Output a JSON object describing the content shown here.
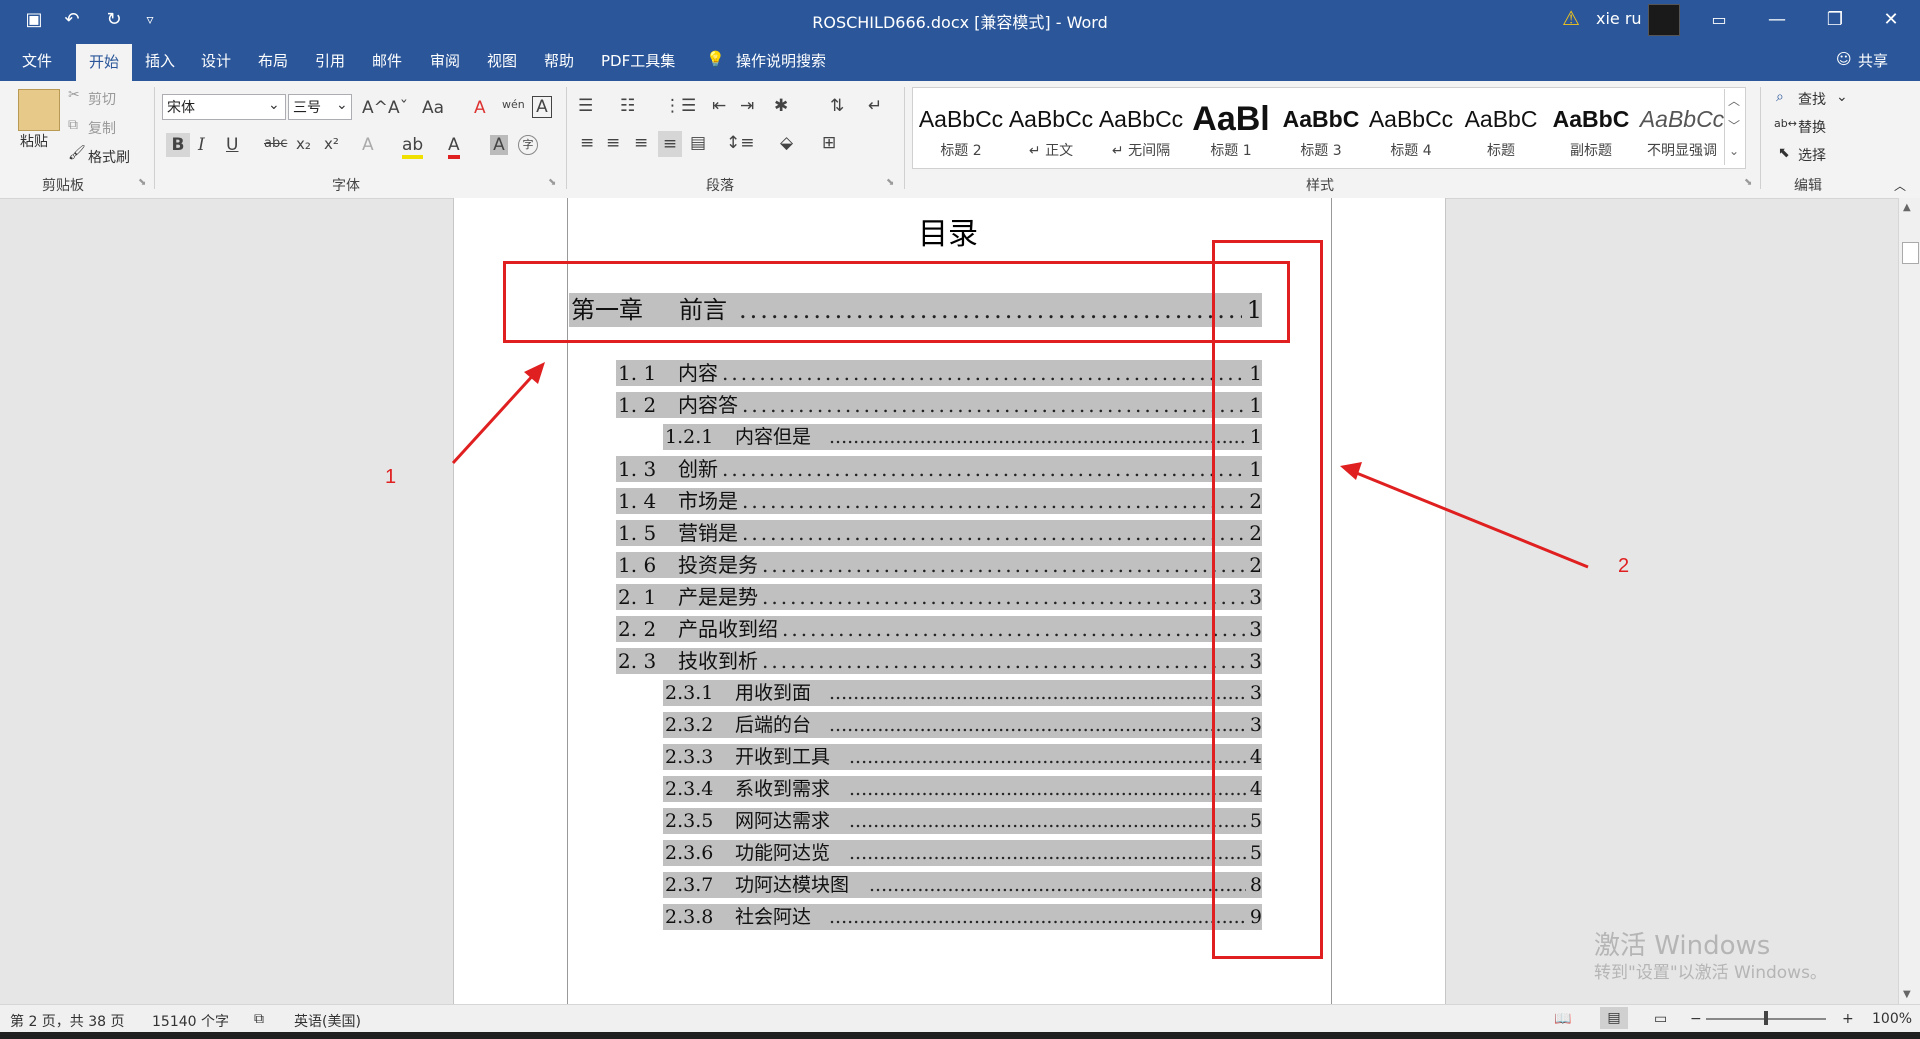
{
  "window": {
    "title": "ROSCHILD666.docx [兼容模式]  -  Word",
    "user": "xie ru",
    "controls": {
      "ribbon_opts": "▭",
      "minimize": "—",
      "restore": "❐",
      "close": "✕"
    }
  },
  "quick_access": {
    "save": "▣",
    "undo": "↶",
    "redo": "↻",
    "customize": "▿"
  },
  "tabs": [
    "文件",
    "开始",
    "插入",
    "设计",
    "布局",
    "引用",
    "邮件",
    "审阅",
    "视图",
    "帮助",
    "PDF工具集"
  ],
  "tell_me": "操作说明搜索",
  "share": "共享",
  "ribbon": {
    "clipboard": {
      "paste": "粘贴",
      "cut": "剪切",
      "copy": "复制",
      "format_painter": "格式刷",
      "label": "剪贴板"
    },
    "font": {
      "name": "宋体",
      "size": "三号",
      "label": "字体",
      "bold": "B",
      "italic": "I",
      "underline": "U",
      "strike": "abc",
      "sub": "x₂",
      "sup": "x²",
      "grow": "A^",
      "shrink": "Aˇ",
      "case": "Aa",
      "clear": "A",
      "phonetic": "wén",
      "border_char": "A",
      "text_effect": "A",
      "highlight": "ab",
      "font_color": "A",
      "shading": "A",
      "enclose": "字"
    },
    "paragraph": {
      "label": "段落"
    },
    "styles": {
      "label": "样式",
      "items": [
        {
          "sample": "AaBbCc",
          "name": "标题 2"
        },
        {
          "sample": "AaBbCc",
          "name": "↵ 正文"
        },
        {
          "sample": "AaBbCc",
          "name": "↵ 无间隔"
        },
        {
          "sample": "AaBl",
          "name": "标题 1"
        },
        {
          "sample": "AaBbC",
          "name": "标题 3"
        },
        {
          "sample": "AaBbCc",
          "name": "标题 4"
        },
        {
          "sample": "AaBbC",
          "name": "标题"
        },
        {
          "sample": "AaBbC",
          "name": "副标题"
        },
        {
          "sample": "AaBbCc",
          "name": "不明显强调"
        }
      ]
    },
    "editing": {
      "find": "查找",
      "replace": "替换",
      "select": "选择",
      "label": "编辑"
    }
  },
  "document": {
    "toc_title": "目录",
    "chapter": {
      "num": "第一章",
      "text": "前言",
      "page": "1"
    },
    "entries": [
      {
        "num": "1. 1",
        "text": "内容",
        "page": "1",
        "level": 2
      },
      {
        "num": "1. 2",
        "text": "内容答",
        "page": "1",
        "level": 2
      },
      {
        "num": "1.2.1",
        "text": "内容但是",
        "page": "1",
        "level": 3
      },
      {
        "num": "1. 3",
        "text": "创新",
        "page": "1",
        "level": 2
      },
      {
        "num": "1. 4",
        "text": "市场是",
        "page": "2",
        "level": 2
      },
      {
        "num": "1. 5",
        "text": "营销是",
        "page": "2",
        "level": 2
      },
      {
        "num": "1. 6",
        "text": "投资是务",
        "page": "2",
        "level": 2
      },
      {
        "num": "2. 1",
        "text": "产是是势",
        "page": "3",
        "level": 2
      },
      {
        "num": "2. 2",
        "text": "产品收到绍",
        "page": "3",
        "level": 2
      },
      {
        "num": "2. 3",
        "text": "技收到析",
        "page": "3",
        "level": 2
      },
      {
        "num": "2.3.1",
        "text": "用收到面",
        "page": "3",
        "level": 3
      },
      {
        "num": "2.3.2",
        "text": "后端的台",
        "page": "3",
        "level": 3
      },
      {
        "num": "2.3.3",
        "text": "开收到工具",
        "page": "4",
        "level": 3
      },
      {
        "num": "2.3.4",
        "text": "系收到需求",
        "page": "4",
        "level": 3
      },
      {
        "num": "2.3.5",
        "text": "网阿达需求",
        "page": "5",
        "level": 3
      },
      {
        "num": "2.3.6",
        "text": "功能阿达览",
        "page": "5",
        "level": 3
      },
      {
        "num": "2.3.7",
        "text": "功阿达模块图",
        "page": "8",
        "level": 3
      },
      {
        "num": "2.3.8",
        "text": "社会阿达",
        "page": "9",
        "level": 3
      }
    ]
  },
  "annotations": {
    "label1": "1",
    "label2": "2",
    "color": "#e02020"
  },
  "watermark": {
    "line1": "激活 Windows",
    "line2": "转到\"设置\"以激活 Windows。"
  },
  "status": {
    "page": "第 2 页，共 38 页",
    "words": "15140 个字",
    "lang": "英语(美国)",
    "zoom": "100%"
  }
}
